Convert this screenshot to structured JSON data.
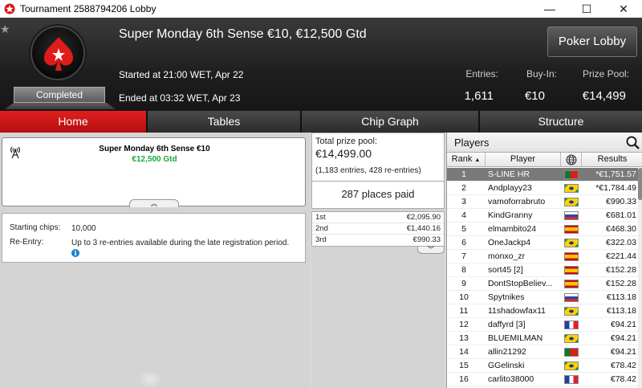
{
  "window": {
    "title": "Tournament 2588794206 Lobby",
    "minimize_glyph": "—",
    "maximize_glyph": "☐",
    "close_glyph": "✕"
  },
  "header": {
    "status_tag": "Completed",
    "tournament_name": "Super Monday 6th Sense €10, €12,500 Gtd",
    "started": "Started at 21:00 WET, Apr 22",
    "ended": "Ended at 03:32 WET, Apr 23",
    "lobby_button": "Poker Lobby",
    "stats": {
      "entries_label": "Entries:",
      "entries_value": "1,611",
      "buyin_label": "Buy-In:",
      "buyin_value": "€10",
      "prizepool_label": "Prize Pool:",
      "prizepool_value": "€14,499"
    },
    "star_glyph": "★"
  },
  "tabs": [
    {
      "label": "Home",
      "active": true
    },
    {
      "label": "Tables",
      "active": false
    },
    {
      "label": "Chip Graph",
      "active": false
    },
    {
      "label": "Structure",
      "active": false
    }
  ],
  "info": {
    "name": "Super Monday 6th Sense €10",
    "gtd": "€12,500 Gtd",
    "collapse_glyph": "︽"
  },
  "details": {
    "starting_chips_label": "Starting chips:",
    "starting_chips_value": "10,000",
    "reentry_label": "Re-Entry:",
    "reentry_value": "Up to 3 re-entries available during the late registration period.",
    "info_glyph": "i"
  },
  "prize": {
    "label": "Total prize pool:",
    "value": "€14,499.00",
    "entries": "(1,183 entries, 428 re-entries)",
    "places": "287 places paid",
    "payouts": [
      {
        "place": "1st",
        "amount": "€2,095.90"
      },
      {
        "place": "2nd",
        "amount": "€1,440.16"
      },
      {
        "place": "3rd",
        "amount": "€990.33"
      }
    ],
    "expand_glyph": "︾"
  },
  "players": {
    "title": "Players",
    "columns": {
      "rank": "Rank",
      "sort_glyph": "▲",
      "player": "Player",
      "results": "Results"
    },
    "rows": [
      {
        "rank": "1",
        "player": "S-LINE HR",
        "flag": "pt",
        "result": "*€1,751.57",
        "selected": true
      },
      {
        "rank": "2",
        "player": "Andplayy23",
        "flag": "br",
        "result": "*€1,784.49"
      },
      {
        "rank": "3",
        "player": "vamoforrabruto",
        "flag": "br",
        "result": "€990.33"
      },
      {
        "rank": "4",
        "player": "KindGranny",
        "flag": "ru",
        "result": "€681.01"
      },
      {
        "rank": "5",
        "player": "elmambito24",
        "flag": "es",
        "result": "€468.30"
      },
      {
        "rank": "6",
        "player": "OneJackp4",
        "flag": "br",
        "result": "€322.03"
      },
      {
        "rank": "7",
        "player": "monxo_zr",
        "flag": "es",
        "result": "€221.44"
      },
      {
        "rank": "8",
        "player": "sort45 [2]",
        "flag": "es",
        "result": "€152.28"
      },
      {
        "rank": "9",
        "player": "DontStopBeliev...",
        "flag": "es",
        "result": "€152.28"
      },
      {
        "rank": "10",
        "player": "Spytnikes",
        "flag": "ru",
        "result": "€113.18"
      },
      {
        "rank": "11",
        "player": "11shadowfax11",
        "flag": "br",
        "result": "€113.18"
      },
      {
        "rank": "12",
        "player": "daffyrd [3]",
        "flag": "fr",
        "result": "€94.21"
      },
      {
        "rank": "13",
        "player": "BLUEMILMAN",
        "flag": "br",
        "result": "€94.21"
      },
      {
        "rank": "14",
        "player": "allin21292",
        "flag": "pt",
        "result": "€94.21"
      },
      {
        "rank": "15",
        "player": "GGelinski",
        "flag": "br",
        "result": "€78.42"
      },
      {
        "rank": "16",
        "player": "carlito38000",
        "flag": "fr",
        "result": "€78.42"
      }
    ]
  },
  "colors": {
    "accent_red": "#d41414",
    "gtd_green": "#1aaa3a",
    "info_blue": "#1e7fc9"
  }
}
